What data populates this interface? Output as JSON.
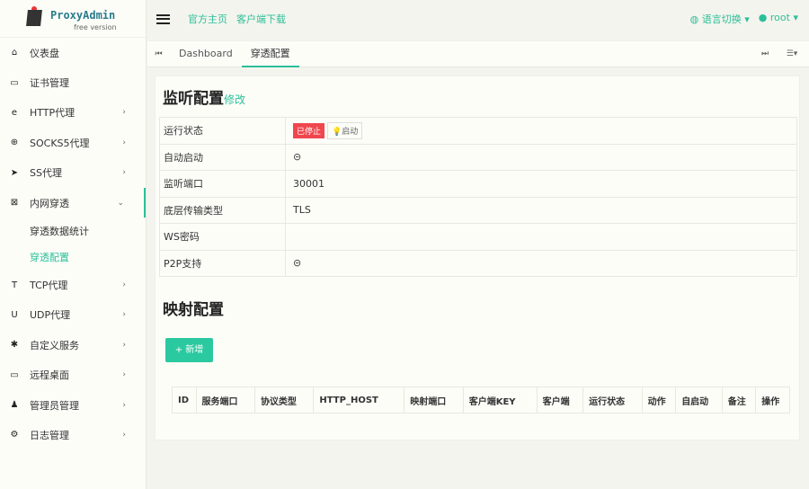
{
  "logo": {
    "title": "ProxyAdmin",
    "subtitle": "free version"
  },
  "sidebar": {
    "items": [
      {
        "label": "仪表盘",
        "icon": "⌂",
        "arrow": ""
      },
      {
        "label": "证书管理",
        "icon": "▭",
        "arrow": ""
      },
      {
        "label": "HTTP代理",
        "icon": "e",
        "arrow": "›"
      },
      {
        "label": "SOCKS5代理",
        "icon": "⊕",
        "arrow": "›"
      },
      {
        "label": "SS代理",
        "icon": "➤",
        "arrow": "›"
      },
      {
        "label": "内网穿透",
        "icon": "⊠",
        "arrow": "⌄"
      },
      {
        "label": "TCP代理",
        "icon": "T",
        "arrow": "›"
      },
      {
        "label": "UDP代理",
        "icon": "U",
        "arrow": "›"
      },
      {
        "label": "自定义服务",
        "icon": "✱",
        "arrow": "›"
      },
      {
        "label": "远程桌面",
        "icon": "▭",
        "arrow": "›"
      },
      {
        "label": "管理员管理",
        "icon": "♟",
        "arrow": "›"
      },
      {
        "label": "日志管理",
        "icon": "⚙",
        "arrow": "›"
      }
    ],
    "subitems": [
      "穿透数据统计",
      "穿透配置"
    ]
  },
  "header": {
    "links": [
      "官方主页",
      "客户端下载"
    ],
    "language": "语言切换",
    "user": "root"
  },
  "tabs": [
    "Dashboard",
    "穿透配置"
  ],
  "listen": {
    "title": "监听配置",
    "edit": "修改",
    "rows": [
      {
        "key": "运行状态",
        "status": "已停止",
        "action": "启动"
      },
      {
        "key": "自动启动",
        "value": "⊝"
      },
      {
        "key": "监听端口",
        "value": "30001"
      },
      {
        "key": "底层传输类型",
        "value": "TLS"
      },
      {
        "key": "WS密码",
        "value": ""
      },
      {
        "key": "P2P支持",
        "value": "⊝"
      }
    ]
  },
  "mapping": {
    "title": "映射配置",
    "add": "+ 新增",
    "columns": [
      "ID",
      "服务端口",
      "协议类型",
      "HTTP_HOST",
      "映射端口",
      "客户端KEY",
      "客户端",
      "运行状态",
      "动作",
      "自启动",
      "备注",
      "操作"
    ]
  }
}
